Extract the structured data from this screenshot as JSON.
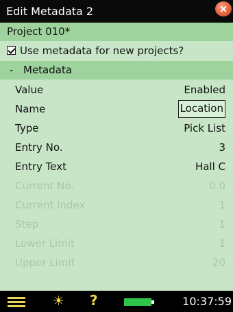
{
  "window": {
    "title": "Edit Metadata 2"
  },
  "project": {
    "name": "Project 010*"
  },
  "options": {
    "use_metadata_label": "Use metadata for new projects?",
    "use_metadata_checked": true
  },
  "section": {
    "collapse_symbol": "-",
    "title": "Metadata"
  },
  "properties": [
    {
      "label": "Value",
      "value": "Enabled",
      "enabled": true
    },
    {
      "label": "Name",
      "value": "Location",
      "enabled": true,
      "selected": true
    },
    {
      "label": "Type",
      "value": "Pick List",
      "enabled": true
    },
    {
      "label": "Entry No.",
      "value": "3",
      "enabled": true
    },
    {
      "label": "Entry Text",
      "value": "Hall C",
      "enabled": true
    },
    {
      "label": "Current No.",
      "value": "0.0",
      "enabled": false
    },
    {
      "label": "Current Index",
      "value": "1",
      "enabled": false
    },
    {
      "label": "Step",
      "value": "1",
      "enabled": false
    },
    {
      "label": "Lower Limit",
      "value": "1",
      "enabled": false
    },
    {
      "label": "Upper Limit",
      "value": "20",
      "enabled": false
    }
  ],
  "taskbar": {
    "clock": "10:37:59",
    "icons": [
      "menu-icon",
      "backlight-icon",
      "help-icon",
      "battery-icon"
    ],
    "help_glyph": "?",
    "bulb_glyph": "☀"
  },
  "colors": {
    "accent": "#9ed39e",
    "background": "#c8e6c7",
    "close": "#e86a45",
    "battery": "#2fc54a",
    "icon": "#f0d84a"
  }
}
